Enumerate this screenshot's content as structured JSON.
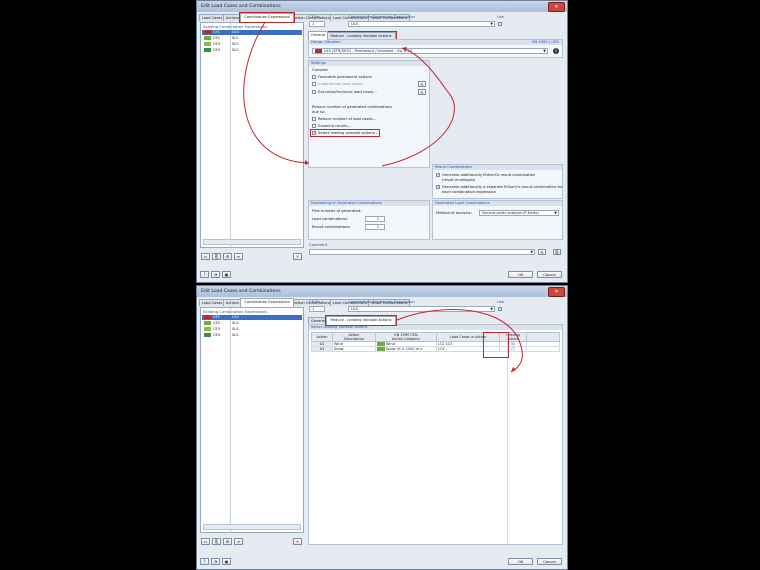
{
  "window_title": "Edit Load Cases and Combinations",
  "tabs": [
    "Load Cases",
    "Actions",
    "Combination Expressions",
    "Action Combinations",
    "Load Combinations",
    "Result Combinations"
  ],
  "existing": {
    "header": "Existing Combination Expressions",
    "rows": [
      {
        "code": "STR",
        "id": "CE1",
        "desc": "ULS",
        "color": "#c0262c"
      },
      {
        "code": "S Ch",
        "id": "CE2",
        "desc": "SLS",
        "color": "#6fae3b"
      },
      {
        "code": "S Fr",
        "id": "CE3",
        "desc": "SLS",
        "color": "#8bbd4f"
      },
      {
        "code": "S Qp",
        "id": "CE4",
        "desc": "SLS",
        "color": "#3d8c40"
      }
    ]
  },
  "ce_no": {
    "label": "CE No.",
    "value": "1"
  },
  "ce_desc": {
    "label": "Combination Expression Description",
    "value": "ULS"
  },
  "use": {
    "label": "Use",
    "mark": "✓"
  },
  "inner_tabs": {
    "general": "General",
    "reduce": "Reduce - Leading Variable Actions"
  },
  "design": {
    "label": "Design Situation",
    "standard": "EN 1990 | CEN",
    "code": "STR",
    "value": "ULS (STR/GEO) - Permanent / transient - Eq. 6.10",
    "info": "i"
  },
  "settings": {
    "title": "Settings",
    "consider": "Consider",
    "favorable": "Favorable permanent actions",
    "imperfection": "Imperfection load cases...",
    "exclusive": "Exclusive/Inclusive load cases...",
    "reduce_text1": "Reduce number of generated combinations",
    "reduce_text2": "due to:",
    "reduce_load_cases": "Reduce number of load cases...",
    "examine": "Examine results...",
    "select_leading": "Select leading variable actions...",
    "select_leading_checked": "✓"
  },
  "result_combinations": {
    "title": "Result Combinations",
    "opt1a": "Generate additionally Either/Or-result combination",
    "opt1b": "(result envelopes)",
    "opt2a": "Generate additionally a separate Either/Or-result combination for",
    "opt2b": "each combination expression",
    "mark": "✓"
  },
  "numbering": {
    "title": "Numbering of Generated Combinations",
    "first": "First number of generated:",
    "load_comb": "Load combinations:",
    "load_comb_val": "1",
    "result_comb": "Result combinations:",
    "result_comb_val": "1"
  },
  "generated": {
    "title": "Generated Load Combinations",
    "method_label": "Method of analysis:",
    "method_value": "Second-order analysis (P-Delta)"
  },
  "comment": {
    "label": "Comment"
  },
  "buttons": {
    "ok": "OK",
    "cancel": "Cancel"
  },
  "leading": {
    "section": "Select Leading Variable Actions",
    "headers": {
      "action": "Action",
      "desc1": "Action",
      "desc2": "Description",
      "cat1": "EN 1990 CEN",
      "cat2": "Action Category",
      "lc": "Load Cases in Action",
      "lead1": "Leading",
      "lead2": "Actions"
    },
    "rows": [
      {
        "action": "A2",
        "desc": "Wind",
        "cat_code": "Qw",
        "cat": "Wind",
        "lc": "LC2 LC3",
        "leading": "☒"
      },
      {
        "action": "A3",
        "desc": "Snow",
        "cat_code": "Qs",
        "cat": "Snow (H ≤ 1000 m a",
        "lc": "LC4",
        "leading": ""
      }
    ]
  },
  "colors": {
    "accent": "#1f4f9b",
    "annotation": "#c0262c",
    "selection": "#3a6fc4"
  }
}
